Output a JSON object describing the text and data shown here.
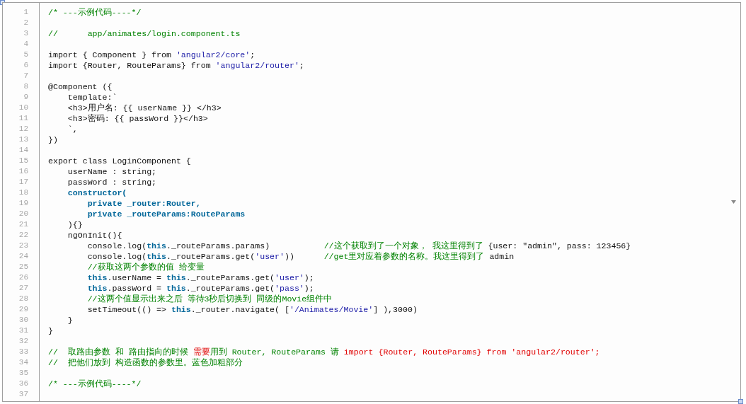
{
  "lines": [
    {
      "number": "1",
      "tokens": [
        {
          "kind": "comment",
          "text": "/* ---示例代码----*/"
        }
      ]
    },
    {
      "number": "2"
    },
    {
      "number": "3",
      "tokens": [
        {
          "kind": "comment",
          "text": "//      app/animates/login.component.ts"
        }
      ]
    },
    {
      "number": "4"
    },
    {
      "number": "5",
      "tokens": [
        {
          "kind": "plain",
          "text": "import { Component } from "
        },
        {
          "kind": "string",
          "text": "'angular2/core'"
        },
        {
          "kind": "plain",
          "text": ";"
        }
      ]
    },
    {
      "number": "6",
      "tokens": [
        {
          "kind": "plain",
          "text": "import {Router, RouteParams} from "
        },
        {
          "kind": "string",
          "text": "'angular2/router'"
        },
        {
          "kind": "plain",
          "text": ";"
        }
      ]
    },
    {
      "number": "7"
    },
    {
      "number": "8",
      "tokens": [
        {
          "kind": "plain",
          "text": "@Component ({"
        }
      ]
    },
    {
      "number": "9",
      "tokens": [
        {
          "kind": "plain",
          "text": "    template:`"
        }
      ]
    },
    {
      "number": "10",
      "tokens": [
        {
          "kind": "plain",
          "text": "    <h3>用户名: {{ userName }} </h3>"
        }
      ]
    },
    {
      "number": "11",
      "tokens": [
        {
          "kind": "plain",
          "text": "    <h3>密码: {{ passWord }}</h3>"
        }
      ]
    },
    {
      "number": "12",
      "tokens": [
        {
          "kind": "plain",
          "text": "    `,"
        }
      ]
    },
    {
      "number": "13",
      "tokens": [
        {
          "kind": "plain",
          "text": "})"
        }
      ]
    },
    {
      "number": "14"
    },
    {
      "number": "15",
      "tokens": [
        {
          "kind": "plain",
          "text": "export class LoginComponent {"
        }
      ]
    },
    {
      "number": "16",
      "tokens": [
        {
          "kind": "plain",
          "text": "    userName : string;"
        }
      ]
    },
    {
      "number": "17",
      "tokens": [
        {
          "kind": "plain",
          "text": "    passWord : string;"
        }
      ]
    },
    {
      "number": "18",
      "tokens": [
        {
          "kind": "keyword",
          "text": "    constructor("
        }
      ]
    },
    {
      "number": "19",
      "tokens": [
        {
          "kind": "keyword",
          "text": "        private _router:Router,"
        }
      ]
    },
    {
      "number": "20",
      "tokens": [
        {
          "kind": "keyword",
          "text": "        private _routeParams:RouteParams"
        }
      ]
    },
    {
      "number": "21",
      "tokens": [
        {
          "kind": "plain",
          "text": "    ){}"
        }
      ]
    },
    {
      "number": "22",
      "tokens": [
        {
          "kind": "plain",
          "text": "    ngOnInit(){"
        }
      ]
    },
    {
      "number": "23",
      "tokens": [
        {
          "kind": "plain",
          "text": "        console.log("
        },
        {
          "kind": "keyword",
          "text": "this"
        },
        {
          "kind": "plain",
          "text": "._routeParams.params)           "
        },
        {
          "kind": "comment",
          "text": "//这个获取到了一个对象， 我这里得到了 "
        },
        {
          "kind": "plain",
          "text": "{user: \"admin\", pass: 123456}"
        }
      ]
    },
    {
      "number": "24",
      "tokens": [
        {
          "kind": "plain",
          "text": "        console.log("
        },
        {
          "kind": "keyword",
          "text": "this"
        },
        {
          "kind": "plain",
          "text": "._routeParams.get("
        },
        {
          "kind": "string",
          "text": "'user'"
        },
        {
          "kind": "plain",
          "text": "))      "
        },
        {
          "kind": "comment",
          "text": "//get里对应着参数的名称。我这里得到了 "
        },
        {
          "kind": "plain",
          "text": "admin"
        }
      ]
    },
    {
      "number": "25",
      "tokens": [
        {
          "kind": "comment",
          "text": "        //获取这两个参数的值 给变量"
        }
      ]
    },
    {
      "number": "26",
      "tokens": [
        {
          "kind": "keyword",
          "text": "        this"
        },
        {
          "kind": "plain",
          "text": ".userName = "
        },
        {
          "kind": "keyword",
          "text": "this"
        },
        {
          "kind": "plain",
          "text": "._routeParams.get("
        },
        {
          "kind": "string",
          "text": "'user'"
        },
        {
          "kind": "plain",
          "text": ");"
        }
      ]
    },
    {
      "number": "27",
      "tokens": [
        {
          "kind": "keyword",
          "text": "        this"
        },
        {
          "kind": "plain",
          "text": ".passWord = "
        },
        {
          "kind": "keyword",
          "text": "this"
        },
        {
          "kind": "plain",
          "text": "._routeParams.get("
        },
        {
          "kind": "string",
          "text": "'pass'"
        },
        {
          "kind": "plain",
          "text": ");"
        }
      ]
    },
    {
      "number": "28",
      "tokens": [
        {
          "kind": "comment",
          "text": "        //这两个值显示出来之后 等待3秒后切换到 同级的Movie组件中"
        }
      ]
    },
    {
      "number": "29",
      "tokens": [
        {
          "kind": "plain",
          "text": "        setTimeout(() => "
        },
        {
          "kind": "keyword",
          "text": "this"
        },
        {
          "kind": "plain",
          "text": "._router.navigate( ["
        },
        {
          "kind": "string",
          "text": "'/Animates/Movie'"
        },
        {
          "kind": "plain",
          "text": "] ),3000)"
        }
      ]
    },
    {
      "number": "30",
      "tokens": [
        {
          "kind": "plain",
          "text": "    }"
        }
      ]
    },
    {
      "number": "31",
      "tokens": [
        {
          "kind": "plain",
          "text": "}"
        }
      ]
    },
    {
      "number": "32"
    },
    {
      "number": "33",
      "tokens": [
        {
          "kind": "comment",
          "text": "//  取路由参数 和 路由指向的时候 "
        },
        {
          "kind": "alert",
          "text": "需要"
        },
        {
          "kind": "comment",
          "text": "用到 Router, RouteParams 请 "
        },
        {
          "kind": "alert",
          "text": "import {Router, RouteParams} from 'angular2/router';"
        }
      ]
    },
    {
      "number": "34",
      "tokens": [
        {
          "kind": "comment",
          "text": "//  把他们放到 构造函数的参数里。蓝色加粗部分"
        }
      ]
    },
    {
      "number": "35"
    },
    {
      "number": "36",
      "tokens": [
        {
          "kind": "comment",
          "text": "/* ---示例代码----*/"
        }
      ]
    },
    {
      "number": "37"
    }
  ]
}
